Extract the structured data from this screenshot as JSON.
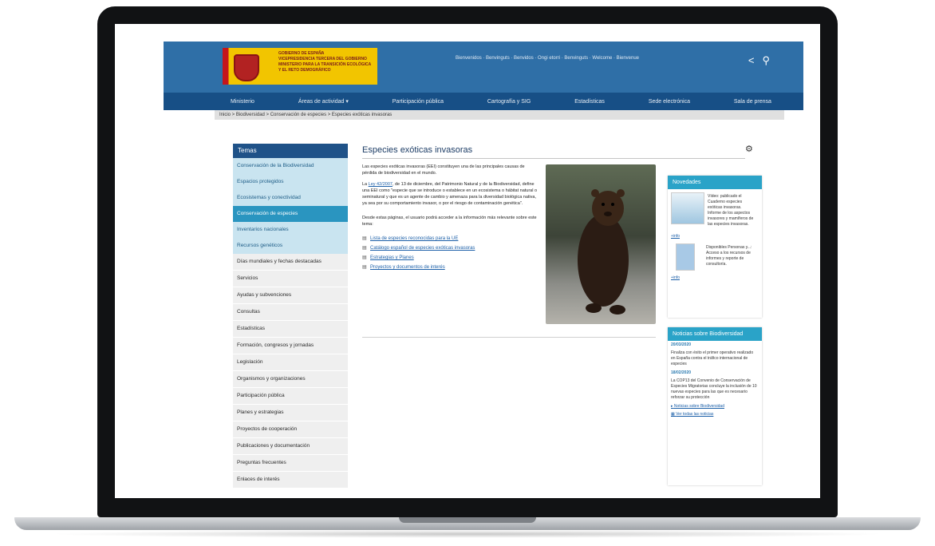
{
  "site": {
    "logo": {
      "line1": "GOBIERNO DE ESPAÑA",
      "line2": "VICEPRESIDENCIA TERCERA DEL GOBIERNO",
      "line3": "MINISTERIO PARA LA TRANSICIÓN ECOLÓGICA Y EL RETO DEMOGRÁFICO"
    },
    "toplinks": "Bienvenidos · Benvinguts · Benvidos · Ongi etorri · Benvinguts · Welcome · Bienvenue",
    "nav": [
      "Ministerio",
      "Áreas de actividad ▾",
      "Participación pública",
      "Cartografía y SIG",
      "Estadísticas",
      "Sede electrónica",
      "Sala de prensa"
    ],
    "breadcrumb": "Inicio  >  Biodiversidad  >  Conservación de especies  >  Especies exóticas invasoras",
    "sidebar": {
      "title": "Temas",
      "items": [
        "Conservación de la Biodiversidad",
        "Espacios protegidos",
        "Ecosistemas y conectividad",
        "Conservación de especies",
        "Inventarios nacionales",
        "Recursos genéticos",
        "Días mundiales y fechas destacadas",
        "Servicios",
        "Ayudas y subvenciones",
        "Consultas",
        "Estadísticas",
        "Formación, congresos y jornadas",
        "Legislación",
        "Organismos y organizaciones",
        "Participación pública",
        "Planes y estrategias",
        "Proyectos de cooperación",
        "Publicaciones y documentación",
        "Preguntas frecuentes",
        "Enlaces de interés"
      ]
    },
    "main": {
      "title": "Especies exóticas invasoras",
      "para1": "Las especies exóticas invasoras (EEI) constituyen una de las principales causas de pérdida de biodiversidad en el mundo.",
      "para2_prefix": "La ",
      "para2_link": "Ley 42/2007",
      "para2_rest": ", de 13 de diciembre, del Patrimonio Natural y de la Biodiversidad, define una EEI como \"especie que se introduce o establece en un ecosistema o hábitat natural o seminatural y que es un agente de cambio y amenaza para la diversidad biológica nativa, ya sea por su comportamiento invasor, o por el riesgo de contaminación genética\".",
      "para3": "Desde estas páginas, el usuario podrá acceder a la información más relevante sobre este tema:",
      "links": [
        "Lista de especies reconocidas para la UE",
        "Catálogo español de especies exóticas invasoras",
        "Estrategias y Planes",
        "Proyectos y documentos de interés"
      ]
    },
    "news": {
      "title": "Novedades",
      "item1": "Vídeo: publicado el Cuaderno especies exóticas invasoras. Informe de los aspectos invasores y mamíferos de las especies invasoras.",
      "item1_link": "+info",
      "item2": "Disponibles Personas y...: Acceso a los recursos de informes y reporte de consultoría.",
      "item2_link": "+info"
    },
    "bionews": {
      "title": "Noticias sobre Biodiversidad",
      "date1": "20/03/2020",
      "text1": "Finaliza con éxito el primer operativo realizado en España contra el tráfico internacional de especies",
      "date2": "18/02/2020",
      "text2": "La COP13 del Convenio de Conservación de Especies Migratorias concluye la inclusión de 10 nuevas especies para las que es necesario reforzar su protección",
      "link1": "Noticias sobre Biodiversidad",
      "link2": "Ver todas las noticias"
    }
  }
}
